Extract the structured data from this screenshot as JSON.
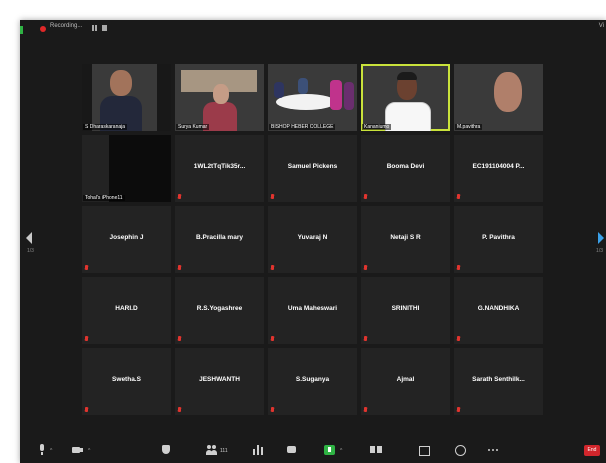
{
  "meeting": {
    "recording_label": "Recording...",
    "view_label": "Vi",
    "page_left": "1/3",
    "page_right": "1/3"
  },
  "participants": [
    {
      "name": "S Dharaskaranaja",
      "type": "video"
    },
    {
      "name": "Surya Kumar",
      "type": "video"
    },
    {
      "name": "BISHOP HEBER COLLEGE",
      "type": "video"
    },
    {
      "name": "Kananiumo",
      "type": "video",
      "active": true
    },
    {
      "name": "M.pavithra",
      "type": "video"
    },
    {
      "name": "Tohal's iPhone11",
      "type": "dark"
    },
    {
      "name": "1WL2tTqTik35r...",
      "type": "name"
    },
    {
      "name": "Samuel Pickens",
      "type": "name"
    },
    {
      "name": "Booma Devi",
      "type": "name"
    },
    {
      "name": "EC191104004 P...",
      "type": "name"
    },
    {
      "name": "Josephin J",
      "type": "name"
    },
    {
      "name": "B.Pracilla mary",
      "type": "name"
    },
    {
      "name": "Yuvaraj N",
      "type": "name"
    },
    {
      "name": "Netaji S R",
      "type": "name"
    },
    {
      "name": "P. Pavithra",
      "type": "name"
    },
    {
      "name": "HARI.D",
      "type": "name"
    },
    {
      "name": "R.S.Yogashree",
      "type": "name"
    },
    {
      "name": "Uma Maheswari",
      "type": "name"
    },
    {
      "name": "SRINITHI",
      "type": "name"
    },
    {
      "name": "G.NANDHIKA",
      "type": "name"
    },
    {
      "name": "Swetha.S",
      "type": "name"
    },
    {
      "name": "JESHWANTH",
      "type": "name"
    },
    {
      "name": "S.Suganya",
      "type": "name"
    },
    {
      "name": "Ajmal",
      "type": "name"
    },
    {
      "name": "Sarath Senthilk...",
      "type": "name"
    }
  ],
  "toolbar": {
    "participants_count": "111",
    "end_label": "End",
    "buttons": [
      "mute",
      "stop-video",
      "security",
      "participants",
      "polls",
      "chat",
      "share-screen",
      "record",
      "breakout-rooms",
      "reactions",
      "more"
    ]
  },
  "colors": {
    "active_speaker": "#c9e23b",
    "mic_muted": "#e0342f",
    "share_green": "#2fb344",
    "end_red": "#d2262c"
  }
}
